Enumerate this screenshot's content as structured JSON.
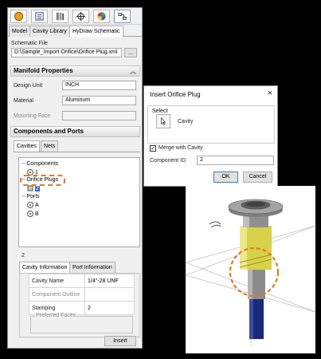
{
  "panel": {
    "toolbar": {
      "icons": [
        "hand-icon",
        "list-icon",
        "library-icon",
        "crosshair-icon",
        "palette-icon",
        "schematic-icon"
      ]
    },
    "tabs": [
      {
        "label": "Model",
        "active": false
      },
      {
        "label": "Cavity Library",
        "active": false
      },
      {
        "label": "HyDraw Schematic",
        "active": true
      }
    ],
    "schematic_file": {
      "label": "Schematic File",
      "value": "D:\\Sample_Import Orifice\\Orifice Plug.xml",
      "browse_label": "..."
    },
    "manifold": {
      "header": "Manifold Properties",
      "design_unit_label": "Design Unit",
      "design_unit_value": "INCH",
      "material_label": "Material",
      "material_value": "Aluminum",
      "mounting_face_label": "Mounting Face",
      "mounting_face_value": ""
    },
    "components_ports": {
      "header": "Components and Ports",
      "subtabs": [
        {
          "label": "Cavities",
          "active": true
        },
        {
          "label": "Nets",
          "active": false
        }
      ],
      "tree": {
        "components_label": "Components",
        "component_1": "1",
        "orifice_label": "Orifice Plugs",
        "orifice_2": "2",
        "ports_label": "Ports",
        "port_a": "A",
        "port_b": "B"
      }
    },
    "selection": {
      "number": "2",
      "tabs": [
        {
          "label": "Cavity Information",
          "active": true
        },
        {
          "label": "Port Information",
          "active": false
        }
      ],
      "rows": [
        {
          "name": "Cavity Name",
          "value": "1/4\"-28 UNF"
        },
        {
          "name": "Component Outline",
          "value": ""
        },
        {
          "name": "Stamping",
          "value": "2"
        }
      ],
      "preferred_faces_label": "Preferred Faces",
      "insert_label": "Insert"
    }
  },
  "dialog": {
    "title": "Insert Orifice Plug",
    "close_glyph": "×",
    "select_label": "Select",
    "cavity_label": "Cavity",
    "merge_label": "Merge with Cavity",
    "merge_checked": true,
    "component_id_label": "Component ID",
    "component_id_value": "2",
    "ok_label": "OK",
    "cancel_label": "Cancel"
  },
  "view3d": {
    "rotate_icon": "rotate-view-icon"
  },
  "colors": {
    "highlight": "#e07a1f",
    "thread": "#d8d14a",
    "tip": "#1a2a7a"
  }
}
